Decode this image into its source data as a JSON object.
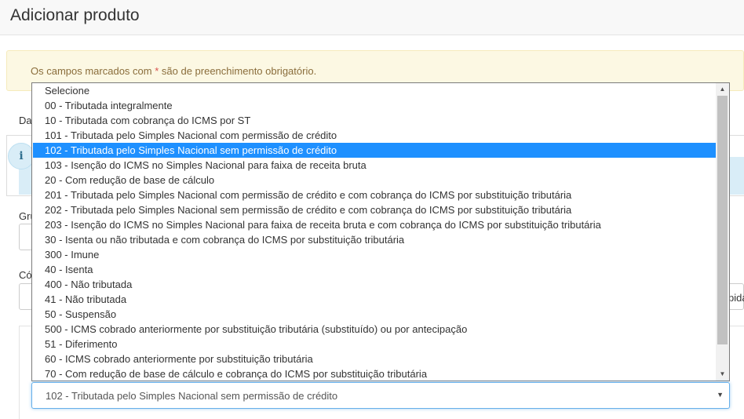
{
  "page": {
    "title": "Adicionar produto"
  },
  "alert": {
    "text_before": "Os campos marcados com ",
    "star": "*",
    "text_after": " são de preenchimento obrigatório."
  },
  "background": {
    "tab_label_partial": "Da",
    "info_icon": "i",
    "field1_label_partial": "Gru",
    "field2_label_partial": "Có",
    "right_text_partial": "pida"
  },
  "select": {
    "selected_value": "102 - Tributada pelo Simples Nacional sem permissão de crédito",
    "caret": "▼",
    "options": [
      "Selecione",
      "00 - Tributada integralmente",
      "10 - Tributada com cobrança do ICMS por ST",
      "101 - Tributada pelo Simples Nacional com permissão de crédito",
      "102 - Tributada pelo Simples Nacional sem permissão de crédito",
      "103 - Isenção do ICMS no Simples Nacional para faixa de receita bruta",
      "20 - Com redução de base de cálculo",
      "201 - Tributada pelo Simples Nacional com permissão de crédito e com cobrança do ICMS por substituição tributária",
      "202 - Tributada pelo Simples Nacional sem permissão de crédito e com cobrança do ICMS por substituição tributária",
      "203 - Isenção do ICMS no Simples Nacional para faixa de receita bruta e com cobrança do ICMS por substituição tributária",
      "30 - Isenta ou não tributada e com cobrança do ICMS por substituição tributária",
      "300 - Imune",
      "40 - Isenta",
      "400 - Não tributada",
      "41 - Não tributada",
      "50 - Suspensão",
      "500 - ICMS cobrado anteriormente por substituição tributária (substituído) ou por antecipação",
      "51 - Diferimento",
      "60 - ICMS cobrado anteriormente por substituição tributária",
      "70 - Com redução de base de cálculo e cobrança do ICMS por substituição tributária"
    ],
    "highlighted_index": 4
  },
  "scrollbar": {
    "up_arrow": "▲",
    "down_arrow": "▼"
  },
  "colors": {
    "highlight": "#1e90ff",
    "alert_bg": "#fcf8e3",
    "alert_text": "#8a6d3b",
    "required_star": "#d9534f",
    "info_bg": "#d9edf7"
  }
}
